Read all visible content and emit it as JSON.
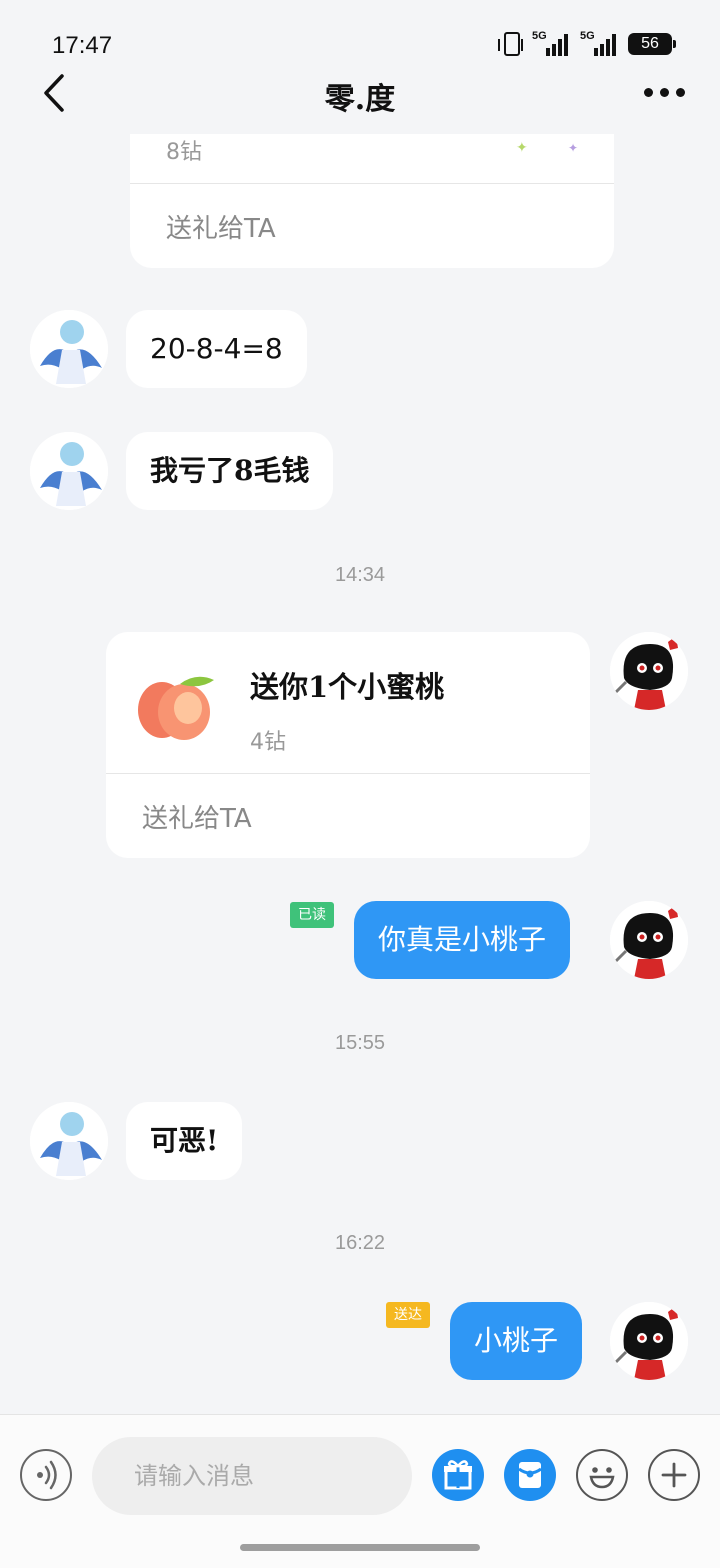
{
  "status": {
    "time": "17:47",
    "battery": "56",
    "network1": "5G",
    "network2": "5G"
  },
  "header": {
    "title": "零.度",
    "back_icon": "back-arrow-icon",
    "more_icon": "more-dots-icon"
  },
  "messages": {
    "top_gift": {
      "price": "8钻",
      "action": "送礼给TA"
    },
    "m1": "20-8-4=8",
    "m2": "我亏了8毛钱",
    "ts1": "14:34",
    "gift": {
      "name": "送你1个小蜜桃",
      "price": "4钻",
      "action": "送礼给TA"
    },
    "m3": "你真是小桃子",
    "m3_status": "已读",
    "ts2": "15:55",
    "m4": "可恶!",
    "ts3": "16:22",
    "m5": "小桃子",
    "m5_status": "送达"
  },
  "input": {
    "placeholder": "请输入消息"
  },
  "colors": {
    "my_bubble": "#2f97f5",
    "read_badge": "#3fc27a",
    "delivered_badge": "#f5b820",
    "accent": "#1f8ff0"
  },
  "icons": [
    "voice-icon",
    "gift-icon",
    "red-packet-icon",
    "emoji-icon",
    "plus-icon"
  ]
}
